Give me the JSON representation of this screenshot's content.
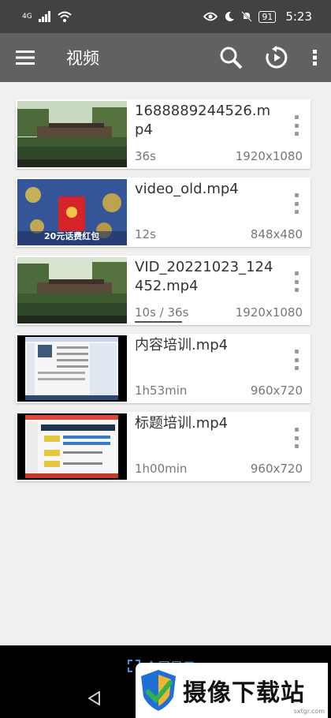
{
  "status_bar": {
    "network": "4G",
    "battery": "91",
    "time": "5:23"
  },
  "toolbar": {
    "title": "视频",
    "icons": [
      "menu-icon",
      "search-icon",
      "refresh-play-icon",
      "more-vert-icon"
    ]
  },
  "videos": [
    {
      "name": "1688889244526.mp4",
      "duration": "36s",
      "resolution": "1920x1080",
      "thumb": "lake-pavilion"
    },
    {
      "name": "video_old.mp4",
      "duration": "12s",
      "resolution": "848x480",
      "thumb": "game-red-envelope",
      "thumb_caption": "20元话费红包"
    },
    {
      "name": "VID_20221023_124452.mp4",
      "duration": "10s / 36s",
      "resolution": "1920x1080",
      "thumb": "lake-pavilion",
      "progress": 0.28
    },
    {
      "name": "内容培训.mp4",
      "duration": "1h53min",
      "resolution": "960x720",
      "thumb": "screen-recording"
    },
    {
      "name": "标题培训.mp4",
      "duration": "1h00min",
      "resolution": "960x720",
      "thumb": "slides-recording"
    }
  ],
  "bottom": {
    "fullscreen_label": "全屏显示"
  },
  "watermark": {
    "text": "摄像下载站",
    "url": "sxtgr.com"
  },
  "colors": {
    "status_bar": "#424242",
    "toolbar": "#616161",
    "background": "#f0f0f0",
    "accent": "#3a8ee6"
  }
}
